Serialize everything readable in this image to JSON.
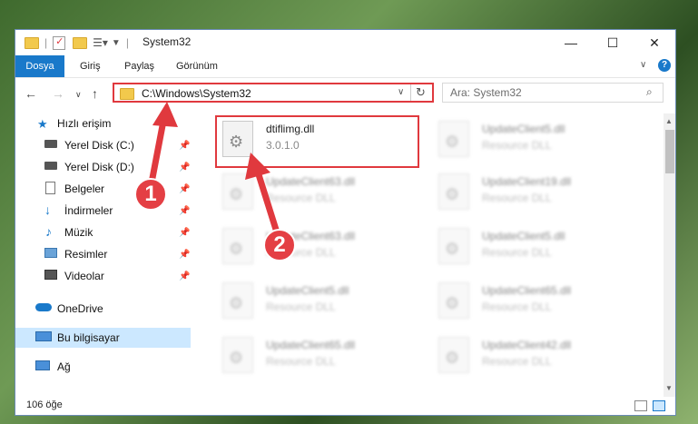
{
  "window": {
    "title": "System32",
    "controls": {
      "minimize": "—",
      "maximize": "☐",
      "close": "✕"
    }
  },
  "ribbon": {
    "tabs": [
      "Dosya",
      "Giriş",
      "Paylaş",
      "Görünüm"
    ]
  },
  "nav": {
    "address": "C:\\Windows\\System32",
    "search_placeholder": "Ara: System32"
  },
  "sidebar": {
    "items": [
      {
        "label": "Hızlı erişim",
        "icon": "star-icon"
      },
      {
        "label": "Yerel Disk (C:)",
        "icon": "drive-icon"
      },
      {
        "label": "Yerel Disk (D:)",
        "icon": "drive-icon"
      },
      {
        "label": "Belgeler",
        "icon": "document-icon"
      },
      {
        "label": "İndirmeler",
        "icon": "download-icon"
      },
      {
        "label": "Müzik",
        "icon": "music-icon"
      },
      {
        "label": "Resimler",
        "icon": "pictures-icon"
      },
      {
        "label": "Videolar",
        "icon": "video-icon"
      },
      {
        "label": "OneDrive",
        "icon": "cloud-icon"
      },
      {
        "label": "Bu bilgisayar",
        "icon": "computer-icon"
      },
      {
        "label": "Ağ",
        "icon": "network-icon"
      }
    ]
  },
  "files": [
    {
      "name": "dtiflimg.dll",
      "desc": "3.0.1.0"
    },
    {
      "name": "UpdateClient5.dll",
      "desc": "Resource DLL"
    },
    {
      "name": "UpdateClient63.dll",
      "desc": "Resource DLL"
    },
    {
      "name": "UpdateClient19.dll",
      "desc": "Resource DLL"
    },
    {
      "name": "UpdateClient63.dll",
      "desc": "Resource DLL"
    },
    {
      "name": "UpdateClient5.dll",
      "desc": "Resource DLL"
    },
    {
      "name": "UpdateClient5.dll",
      "desc": "Resource DLL"
    },
    {
      "name": "UpdateClient65.dll",
      "desc": "Resource DLL"
    },
    {
      "name": "UpdateClient65.dll",
      "desc": "Resource DLL"
    },
    {
      "name": "UpdateClient42.dll",
      "desc": "Resource DLL"
    }
  ],
  "status": {
    "count": "106 öğe"
  },
  "callouts": [
    "1",
    "2"
  ],
  "colors": {
    "accent": "#1979ca",
    "highlight": "#e0393e",
    "selected": "#cce8ff"
  }
}
